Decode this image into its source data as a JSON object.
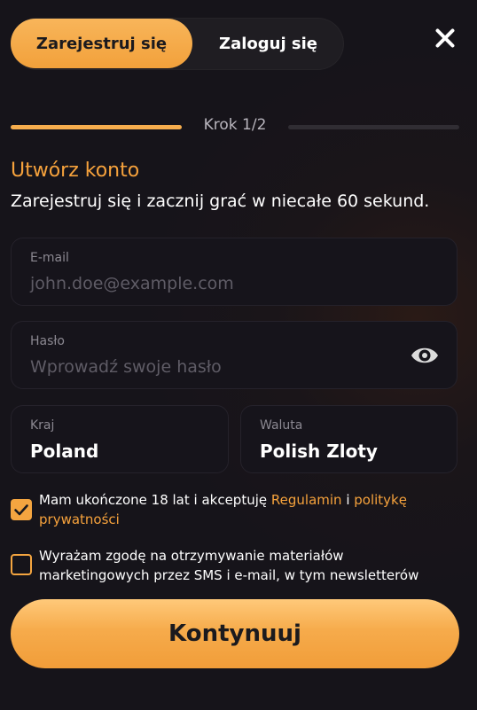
{
  "tabs": {
    "register": "Zarejestruj się",
    "login": "Zaloguj się"
  },
  "progress": {
    "step_label": "Krok 1/2",
    "fraction": 0.5
  },
  "header": {
    "title": "Utwórz konto",
    "subtitle": "Zarejestruj się i zacznij grać w niecałe 60 sekund."
  },
  "fields": {
    "email": {
      "label": "E-mail",
      "placeholder": "john.doe@example.com",
      "value": ""
    },
    "password": {
      "label": "Hasło",
      "placeholder": "Wprowadź swoje hasło",
      "value": ""
    },
    "country": {
      "label": "Kraj",
      "value": "Poland"
    },
    "currency": {
      "label": "Waluta",
      "value": "Polish Zloty"
    }
  },
  "consents": {
    "terms": {
      "checked": true,
      "text_before": "Mam ukończone 18 lat i akceptuję ",
      "link_terms": "Regulamin",
      "text_mid": " i ",
      "link_policy": "politykę prywatności"
    },
    "marketing": {
      "checked": false,
      "text": "Wyrażam zgodę na otrzymywanie materiałów marketingowych przez SMS i e-mail, w tym newsletterów"
    }
  },
  "submit_label": "Kontynuuj",
  "icons": {
    "close": "close-icon",
    "eye": "eye-icon",
    "check": "checkmark-icon"
  },
  "colors": {
    "accent": "#f6a23c",
    "background": "#16141a",
    "field_bg": "#16141b"
  }
}
